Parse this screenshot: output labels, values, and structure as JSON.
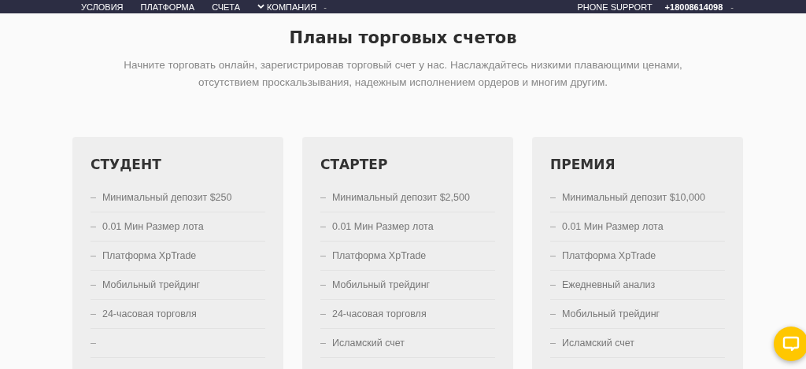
{
  "nav": {
    "links": [
      {
        "label": "УСЛОВИЯ",
        "caret": false
      },
      {
        "label": "ПЛАТФОРМА",
        "caret": false
      },
      {
        "label": "СЧЕТА",
        "caret": false
      },
      {
        "label": "КОМПАНИЯ",
        "caret": true,
        "suffix": "-"
      }
    ],
    "support_label": "PHONE SUPPORT",
    "phone": "+18008614098",
    "phone_suffix": "-"
  },
  "title": "Планы торговых счетов",
  "subtitle": "Начните торговать онлайн, зарегистрировав торговый счет у нас. Наслаждайтесь низкими плавающими ценами, отсутствием проскальзывания, надежным исполнением ордеров и многим другим.",
  "plans": [
    {
      "name": "СТУДЕНТ",
      "features": [
        {
          "marker": "–",
          "text": "Минимальный депозит $250"
        },
        {
          "marker": "–",
          "text": "0.01 Мин Размер лота"
        },
        {
          "marker": "–",
          "text": "Платформа XpTrade"
        },
        {
          "marker": "–",
          "text": "Мобильный трейдинг"
        },
        {
          "marker": "–",
          "text": "24-часовая торговля"
        },
        {
          "marker": "–"
        }
      ]
    },
    {
      "name": "СТАРТЕР",
      "features": [
        {
          "marker": "–",
          "text": "Минимальный депозит $2,500"
        },
        {
          "marker": "–",
          "text": "0.01 Мин Размер лота"
        },
        {
          "marker": "–",
          "text": "Платформа XpTrade"
        },
        {
          "marker": "–",
          "text": "Мобильный трейдинг"
        },
        {
          "marker": "–",
          "text": "24-часовая торговля"
        },
        {
          "marker": "–",
          "text": "Исламский счет"
        }
      ]
    },
    {
      "name": "ПРЕМИЯ",
      "features": [
        {
          "marker": "–",
          "text": "Минимальный депозит $10,000"
        },
        {
          "marker": "–",
          "text": "0.01 Мин Размер лота"
        },
        {
          "marker": "–",
          "text": "Платформа XpTrade"
        },
        {
          "marker": "–",
          "text": "Ежедневный анализ"
        },
        {
          "marker": "–",
          "text": "Мобильный трейдинг"
        },
        {
          "marker": "–",
          "text": "Исламский счет"
        }
      ]
    }
  ]
}
